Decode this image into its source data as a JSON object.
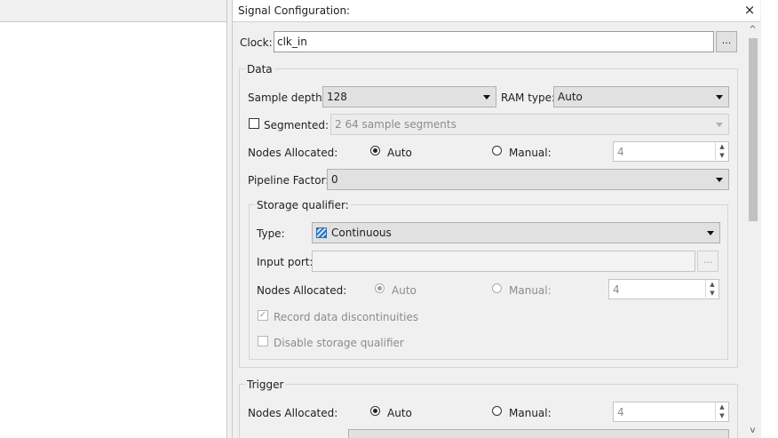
{
  "panel": {
    "title": "Signal Configuration:",
    "close_glyph": "×",
    "clock": {
      "label": "Clock:",
      "value": "clk_in",
      "browse": "..."
    },
    "data": {
      "group_label": "Data",
      "sample_depth": {
        "label": "Sample depth:",
        "value": "128"
      },
      "ram_type": {
        "label": "RAM type:",
        "value": "Auto"
      },
      "segmented": {
        "label": "Segmented:",
        "value": "2  64 sample segments"
      },
      "nodes_allocated": {
        "label": "Nodes Allocated:",
        "auto": "Auto",
        "manual": "Manual:",
        "value": "4"
      },
      "pipeline_factor": {
        "label": "Pipeline Factor:",
        "value": "0"
      },
      "storage": {
        "group_label": "Storage qualifier:",
        "type": {
          "label": "Type:",
          "value": "Continuous",
          "icon": "continuous-icon"
        },
        "input_port": {
          "label": "Input port:",
          "value": "",
          "browse": "..."
        },
        "nodes_allocated": {
          "label": "Nodes Allocated:",
          "auto": "Auto",
          "manual": "Manual:",
          "value": "4"
        },
        "record_discontinuities": "Record data discontinuities",
        "disable_qualifier": "Disable storage qualifier",
        "record_check": "✓"
      }
    },
    "trigger": {
      "group_label": "Trigger",
      "nodes_allocated": {
        "label": "Nodes Allocated:",
        "auto": "Auto",
        "manual": "Manual:",
        "value": "4"
      }
    },
    "scroll": {
      "up": "^",
      "down": "v"
    }
  }
}
